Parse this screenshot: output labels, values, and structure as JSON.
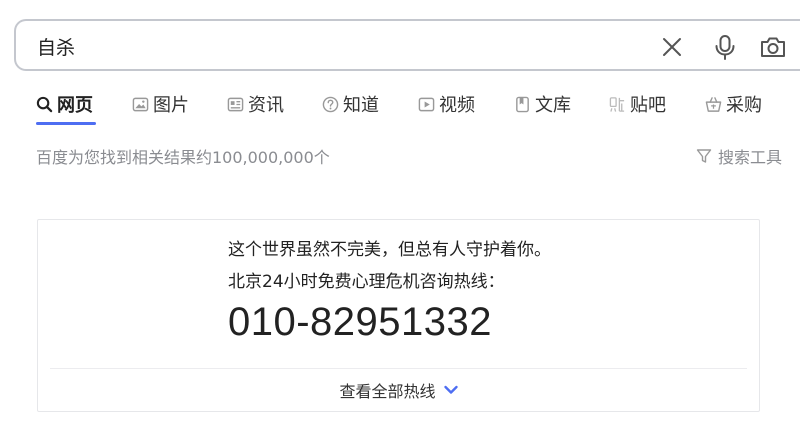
{
  "search": {
    "query": "自杀",
    "icons": [
      "close-icon",
      "microphone-icon",
      "camera-icon"
    ]
  },
  "tabs": [
    {
      "label": "网页",
      "icon": "search-icon",
      "active": true
    },
    {
      "label": "图片",
      "icon": "image-icon",
      "active": false
    },
    {
      "label": "资讯",
      "icon": "news-icon",
      "active": false
    },
    {
      "label": "知道",
      "icon": "question-icon",
      "active": false
    },
    {
      "label": "视频",
      "icon": "video-icon",
      "active": false
    },
    {
      "label": "文库",
      "icon": "document-icon",
      "active": false
    },
    {
      "label": "贴吧",
      "icon": "tieba-icon",
      "active": false
    },
    {
      "label": "采购",
      "icon": "basket-icon",
      "active": false
    }
  ],
  "results": {
    "count_text": "百度为您找到相关结果约100,000,000个",
    "tools_label": "搜索工具"
  },
  "hotline": {
    "line1": "这个世界虽然不完美，但总有人守护着你。",
    "line2": "北京24小时免费心理危机咨询热线：",
    "phone": "010-82951332",
    "expand_label": "查看全部热线"
  },
  "colors": {
    "accent": "#4e6ef2",
    "muted_text": "#8a8c91",
    "border": "#c4c7ce"
  }
}
